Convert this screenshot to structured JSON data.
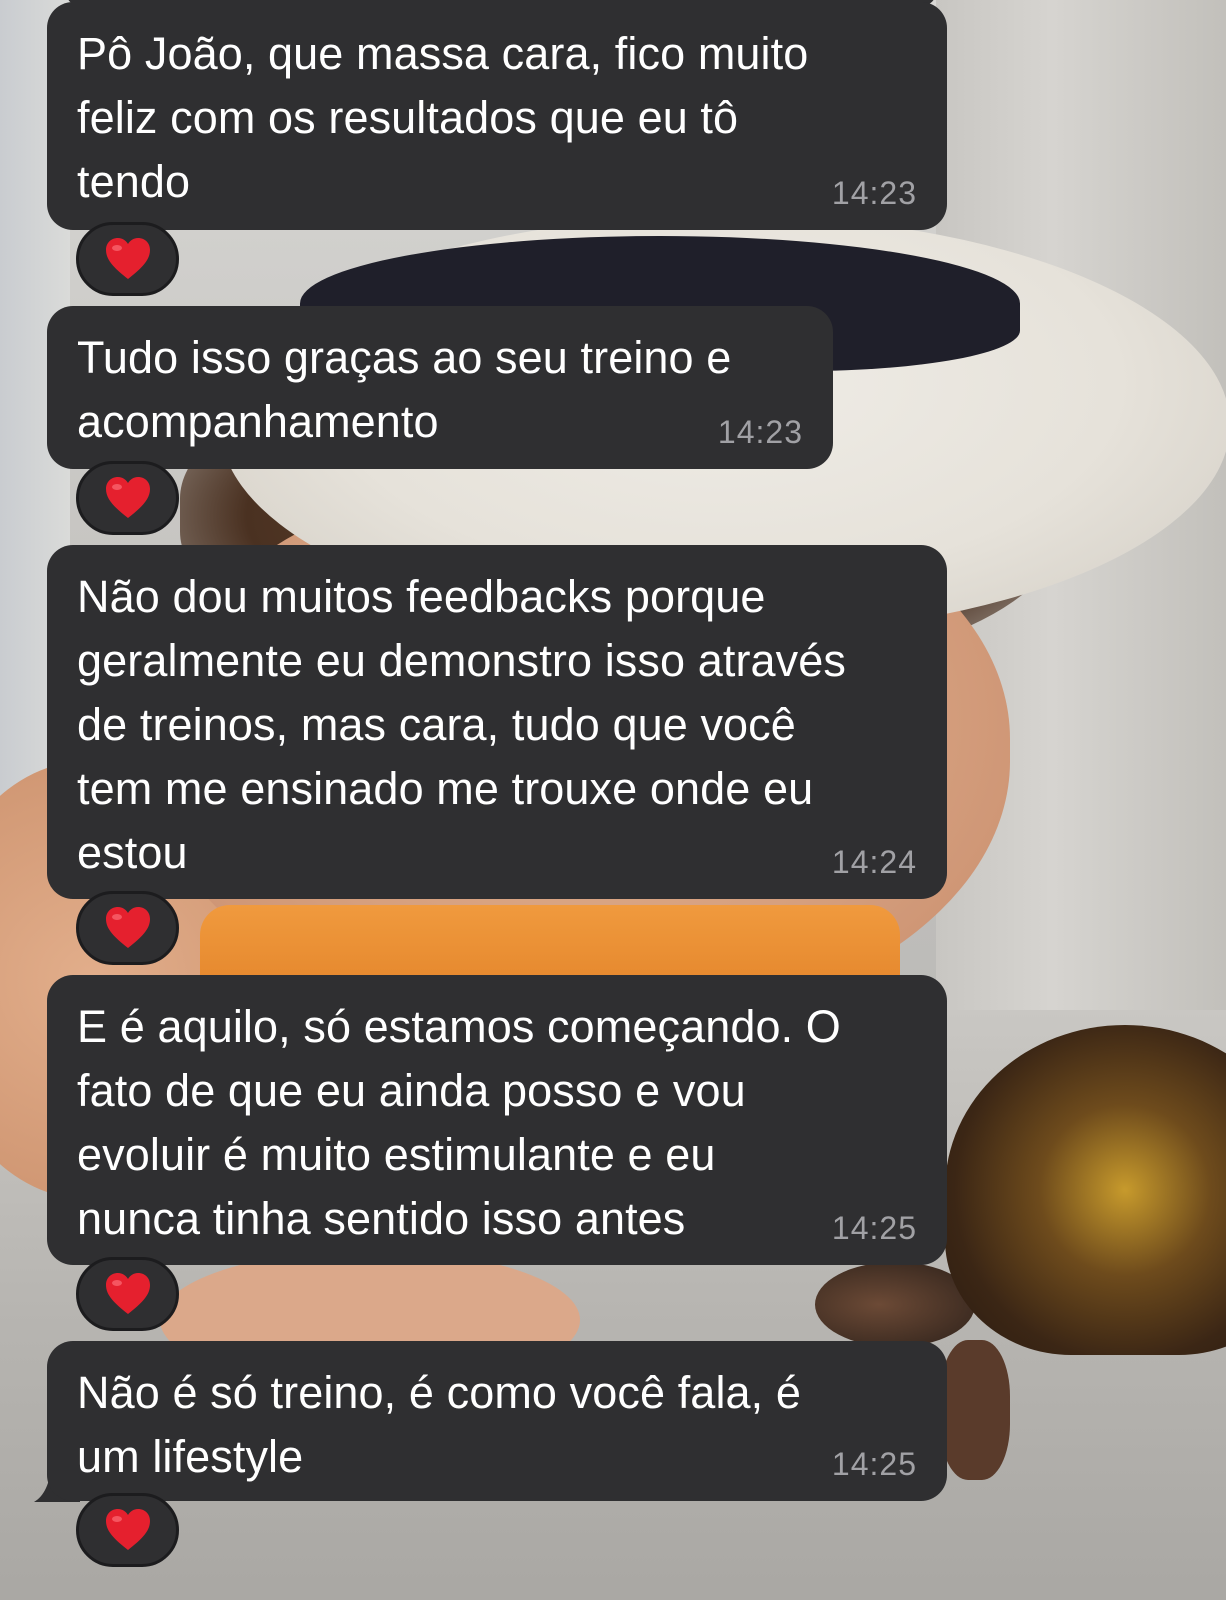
{
  "messages": [
    {
      "text": "Pô João, que massa cara, fico muito\nfeliz com os resultados que eu tô\ntendo",
      "time": "14:23",
      "reaction": "❤️"
    },
    {
      "text": "Tudo isso graças ao seu treino e\nacompanhamento",
      "time": "14:23",
      "reaction": "❤️"
    },
    {
      "text": "Não dou muitos feedbacks porque\ngeralmente eu demonstro isso através\nde treinos, mas cara, tudo que você\ntem me ensinado me trouxe onde eu\nestou",
      "time": "14:24",
      "reaction": "❤️"
    },
    {
      "text": "E é aquilo, só estamos começando. O\nfato de que eu ainda posso e vou\nevoluir é muito estimulante e eu\nnunca tinha sentido isso antes",
      "time": "14:25",
      "reaction": "❤️"
    },
    {
      "text": "Não é só treino, é como você fala, é\num lifestyle",
      "time": "14:25",
      "reaction": "❤️"
    }
  ],
  "colors": {
    "bubble": "#2f2f31",
    "text": "#ffffff",
    "timestamp": "#a1a1a5",
    "heart": "#e5202e"
  },
  "icons": {
    "reaction": "heart-icon"
  }
}
